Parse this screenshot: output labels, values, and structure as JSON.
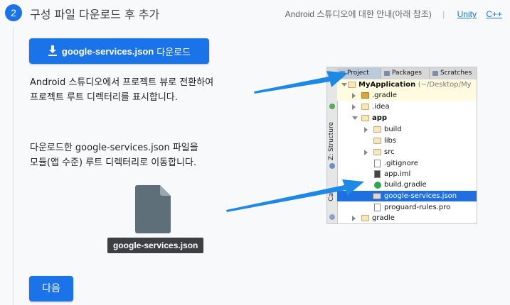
{
  "step": {
    "number": "2",
    "title": "구성 파일 다운로드 후 추가"
  },
  "header": {
    "guide_text": "Android 스튜디오에 대한 안내(아래 참조)",
    "separator": "|",
    "links": [
      "Unity",
      "C++"
    ]
  },
  "download_button": {
    "icon": "download-icon",
    "label_bold": "google-services.json",
    "label_suffix": "다운로드"
  },
  "instructions": {
    "first": "Android 스튜디오에서 프로젝트 뷰로 전환하여\n프로젝트 루트 디렉터리를 표시합니다.",
    "second": "다운로드한 google-services.json 파일을\n모듈(앱 수준) 루트 디렉터리로 이동합니다."
  },
  "file_badge": {
    "icon": "document-file-icon",
    "label": "google-services.json"
  },
  "next_button": {
    "label": "다음"
  },
  "ide": {
    "tabs": [
      "Project",
      "Packages",
      "Scratches"
    ],
    "side_labels": [
      "Z: Structure",
      "Ca"
    ],
    "tree": {
      "root_name": "MyApplication",
      "root_path": "(~/Desktop/My",
      "items": [
        ".gradle",
        ".idea",
        "app",
        "build",
        "libs",
        "src",
        ".gitignore",
        "app.iml",
        "build.gradle",
        "google-services.json",
        "proguard-rules.pro",
        "gradle"
      ]
    }
  },
  "colors": {
    "accent": "#1a73e8",
    "selection": "#1f6fe0",
    "arrow": "#1e88e5"
  }
}
